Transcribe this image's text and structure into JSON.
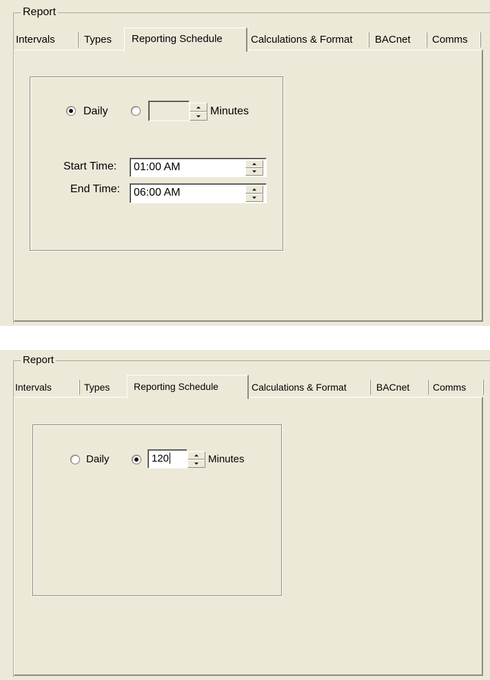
{
  "group_label": "Report",
  "tabs": [
    {
      "label": "Intervals"
    },
    {
      "label": "Types"
    },
    {
      "label": "Reporting Schedule",
      "active": true
    },
    {
      "label": "Calculations & Format"
    },
    {
      "label": "BACnet"
    },
    {
      "label": "Comms"
    }
  ],
  "panel_daily": {
    "daily_label": "Daily",
    "daily_selected": true,
    "minutes_selected": false,
    "minutes_value": "",
    "minutes_label": "Minutes",
    "start_time_label": "Start Time:",
    "start_time_value": "01:00 AM",
    "end_time_label": "End Time:",
    "end_time_value": "06:00 AM"
  },
  "panel_minutes": {
    "daily_label": "Daily",
    "daily_selected": false,
    "minutes_selected": true,
    "minutes_value": "120",
    "minutes_label": "Minutes"
  },
  "icons": {
    "radio_selected": "radio-dot",
    "spinner": "up-down-arrows"
  },
  "colors": {
    "dialog_bg": "#ece9d8",
    "field_bg": "#ffffff"
  }
}
